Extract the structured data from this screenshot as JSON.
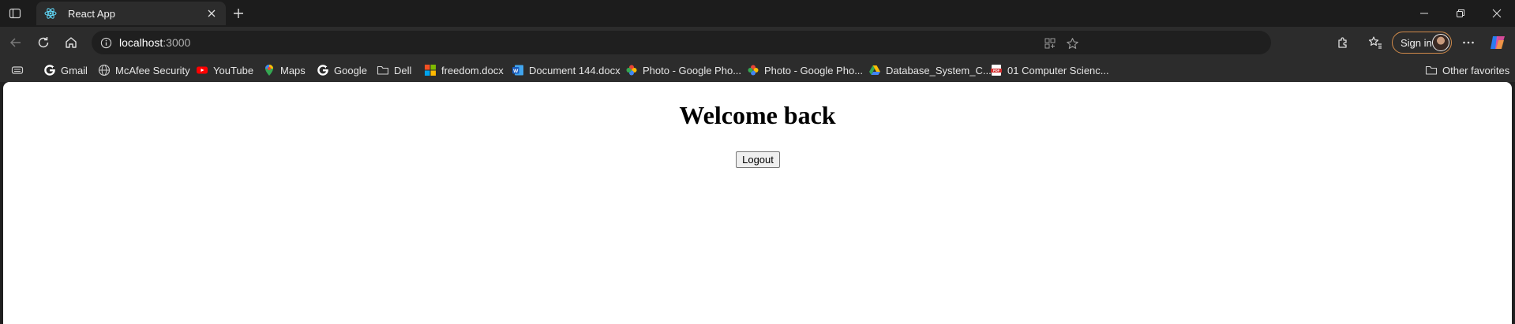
{
  "tab": {
    "title": "React App"
  },
  "omnibox": {
    "host": "localhost",
    "port": ":3000"
  },
  "toolbar": {
    "signin_label": "Sign in"
  },
  "bookmarks": [
    {
      "label": "Gmail",
      "icon": "google-icon"
    },
    {
      "label": "McAfee Security",
      "icon": "globe-icon"
    },
    {
      "label": "YouTube",
      "icon": "youtube-icon"
    },
    {
      "label": "Maps",
      "icon": "maps-pin-icon"
    },
    {
      "label": "Google",
      "icon": "google-icon"
    },
    {
      "label": "Dell",
      "icon": "folder-icon"
    },
    {
      "label": "freedom.docx",
      "icon": "microsoft-icon"
    },
    {
      "label": "Document 144.docx",
      "icon": "word-icon"
    },
    {
      "label": "Photo - Google Pho...",
      "icon": "google-photos-icon"
    },
    {
      "label": "Photo - Google Pho...",
      "icon": "google-photos-icon"
    },
    {
      "label": "Database_System_C...",
      "icon": "google-drive-icon"
    },
    {
      "label": "01 Computer Scienc...",
      "icon": "pdf-icon"
    }
  ],
  "other_favorites": "Other favorites",
  "page": {
    "heading": "Welcome back",
    "logout_label": "Logout"
  },
  "colors": {
    "chrome_bg": "#202020",
    "toolbar_bg": "#2c2c2c",
    "signin_border": "#d08a4a",
    "page_bg": "#ffffff"
  }
}
